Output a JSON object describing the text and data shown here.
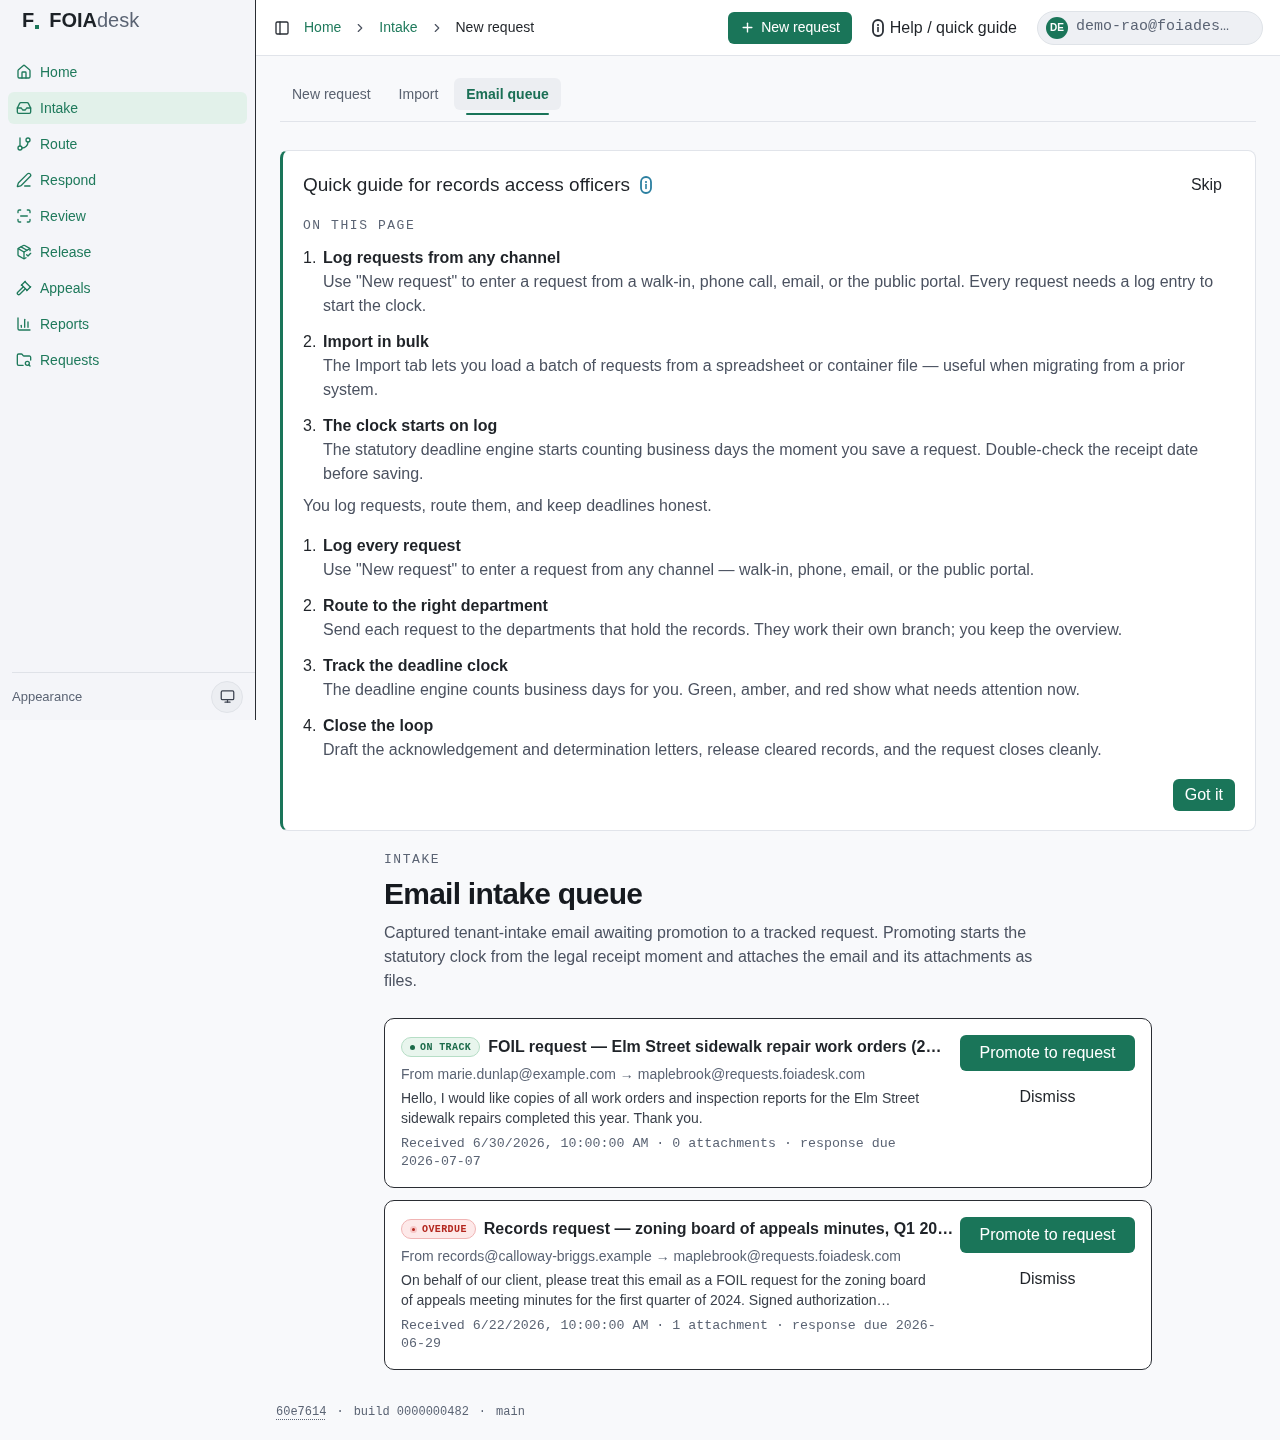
{
  "brand": {
    "mark": "F",
    "name_strong": "FOIA",
    "name_light": "desk"
  },
  "sidebar": {
    "items": [
      {
        "label": "Home",
        "selected": false
      },
      {
        "label": "Intake",
        "selected": true
      },
      {
        "label": "Route",
        "selected": false
      },
      {
        "label": "Respond",
        "selected": false
      },
      {
        "label": "Review",
        "selected": false
      },
      {
        "label": "Release",
        "selected": false
      },
      {
        "label": "Appeals",
        "selected": false
      },
      {
        "label": "Reports",
        "selected": false
      },
      {
        "label": "Requests",
        "selected": false
      }
    ],
    "footer_label": "Appearance"
  },
  "header": {
    "breadcrumb": [
      {
        "label": "Home",
        "current": false
      },
      {
        "label": "Intake",
        "current": false
      },
      {
        "label": "New request",
        "current": true
      }
    ],
    "primary_button": "New request",
    "help_link": "Help / quick guide",
    "user": {
      "initials": "DE",
      "email": "demo-rao@foiades…"
    }
  },
  "tabs": [
    {
      "label": "New request",
      "selected": false
    },
    {
      "label": "Import",
      "selected": false
    },
    {
      "label": "Email queue",
      "selected": true
    }
  ],
  "guide": {
    "title": "Quick guide for records access officers",
    "skip": "Skip",
    "section_label": "ON THIS PAGE",
    "steps": [
      {
        "number": "1.",
        "title": "Log requests from any channel",
        "description": "Use \"New request\" to enter a request from a walk-in, phone call, email, or the public portal. Every request needs a log entry to start the clock."
      },
      {
        "number": "2.",
        "title": "Import in bulk",
        "description": "The Import tab lets you load a batch of requests from a spreadsheet or container file — useful when migrating from a prior system."
      },
      {
        "number": "3.",
        "title": "The clock starts on log",
        "description": "The statutory deadline engine starts counting business days the moment you save a request. Double-check the receipt date before saving."
      }
    ],
    "intro": "You log requests, route them, and keep deadlines honest.",
    "steps_2": [
      {
        "number": "1.",
        "title": "Log every request",
        "description": "Use \"New request\" to enter a request from any channel — walk-in, phone, email, or the public portal."
      },
      {
        "number": "2.",
        "title": "Route to the right department",
        "description": "Send each request to the departments that hold the records. They work their own branch; you keep the overview."
      },
      {
        "number": "3.",
        "title": "Track the deadline clock",
        "description": "The deadline engine counts business days for you. Green, amber, and red show what needs attention now."
      },
      {
        "number": "4.",
        "title": "Close the loop",
        "description": "Draft the acknowledgement and determination letters, release cleared records, and the request closes cleanly."
      }
    ],
    "done_button": "Got it"
  },
  "intake": {
    "eyebrow": "INTAKE",
    "title": "Email intake queue",
    "description": "Captured tenant-intake email awaiting promotion to a tracked request. Promoting starts the statutory clock from the legal receipt moment and attaches the email and its attachments as files.",
    "emails": [
      {
        "status": {
          "kind": "on_track",
          "label": "ON TRACK"
        },
        "subject": "FOIL request — Elm Street sidewalk repair work orders (2…",
        "route": "From marie.dunlap@example.com → maplebrook@requests.foiadesk.com",
        "body": "Hello, I would like copies of all work orders and inspection reports for the Elm Street sidewalk repairs completed this year. Thank you.",
        "meta": "Received 6/30/2026, 10:00:00 AM · 0 attachments · response due 2026-07-07",
        "promote": "Promote to request",
        "dismiss": "Dismiss"
      },
      {
        "status": {
          "kind": "overdue",
          "label": "OVERDUE"
        },
        "subject": "Records request — zoning board of appeals minutes, Q1 20…",
        "route": "From records@calloway-briggs.example → maplebrook@requests.foiadesk.com",
        "body": "On behalf of our client, please treat this email as a FOIL request for the zoning board of appeals meeting minutes for the first quarter of 2024. Signed authorization…",
        "meta": "Received 6/22/2026, 10:00:00 AM · 1 attachment · response due 2026-06-29",
        "promote": "Promote to request",
        "dismiss": "Dismiss"
      }
    ]
  },
  "footer": {
    "separator": "·",
    "items": [
      {
        "kind": "link",
        "text": "60e7614"
      },
      {
        "kind": "build",
        "text": "build 0000000482"
      },
      {
        "kind": "branch",
        "text": "main"
      }
    ]
  }
}
